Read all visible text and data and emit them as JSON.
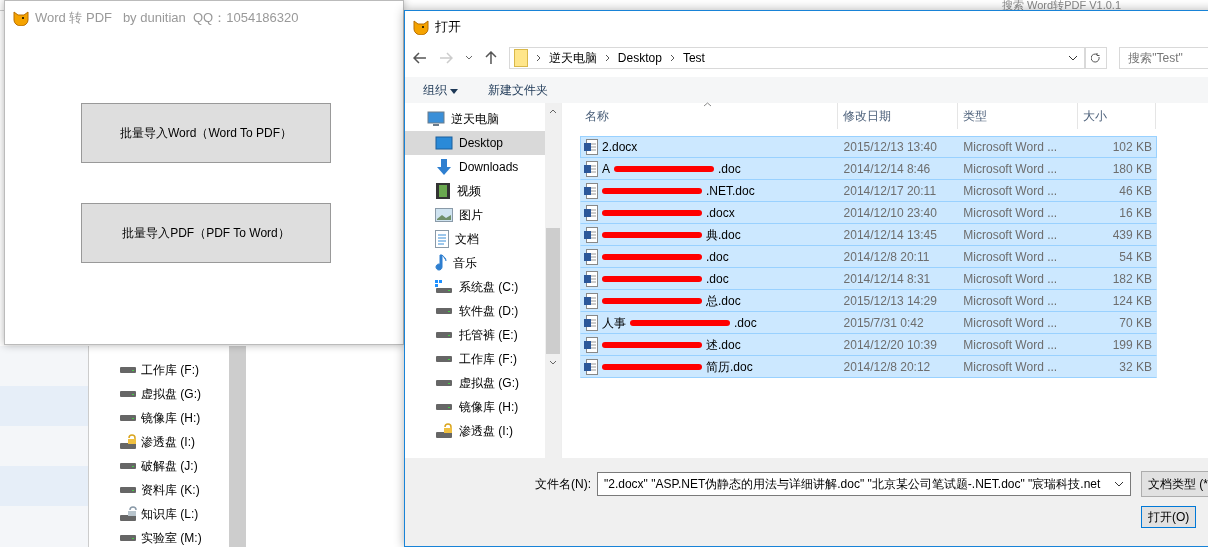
{
  "background_window": {
    "search_placeholder": "搜索 Word转PDF V1.0.1",
    "nav_items": [
      {
        "label": "工作库 (F:)",
        "kind": "drive"
      },
      {
        "label": "虚拟盘 (G:)",
        "kind": "drive"
      },
      {
        "label": "镜像库 (H:)",
        "kind": "drive"
      },
      {
        "label": "渗透盘 (I:)",
        "kind": "locked-drive"
      },
      {
        "label": "破解盘 (J:)",
        "kind": "drive"
      },
      {
        "label": "资料库 (K:)",
        "kind": "drive"
      },
      {
        "label": "知识库 (L:)",
        "kind": "unlocked-drive"
      },
      {
        "label": "实验室 (M:)",
        "kind": "drive"
      }
    ]
  },
  "app_window": {
    "title": "Word 转 PDF   by dunitian  QQ：1054186320",
    "buttons": [
      "批量导入Word（Word To PDF）",
      "批量导入PDF（PDF To Word）"
    ]
  },
  "open_dialog": {
    "title": "打开",
    "breadcrumb": [
      "逆天电脑",
      "Desktop",
      "Test"
    ],
    "search_placeholder": "搜索\"Test\"",
    "toolbar": {
      "organize": "组织",
      "new_folder": "新建文件夹"
    },
    "nav_items": [
      {
        "label": "逆天电脑",
        "kind": "pc",
        "selected": false
      },
      {
        "label": "Desktop",
        "kind": "desktop",
        "selected": true
      },
      {
        "label": "Downloads",
        "kind": "download",
        "selected": false
      },
      {
        "label": "视频",
        "kind": "video",
        "selected": false
      },
      {
        "label": "图片",
        "kind": "picture",
        "selected": false
      },
      {
        "label": "文档",
        "kind": "document",
        "selected": false
      },
      {
        "label": "音乐",
        "kind": "music",
        "selected": false
      },
      {
        "label": "系统盘 (C:)",
        "kind": "system-drive",
        "selected": false
      },
      {
        "label": "软件盘 (D:)",
        "kind": "drive",
        "selected": false
      },
      {
        "label": "托管裤 (E:)",
        "kind": "drive",
        "selected": false
      },
      {
        "label": "工作库 (F:)",
        "kind": "drive",
        "selected": false
      },
      {
        "label": "虚拟盘 (G:)",
        "kind": "drive",
        "selected": false
      },
      {
        "label": "镜像库 (H:)",
        "kind": "drive",
        "selected": false
      },
      {
        "label": "渗透盘 (I:)",
        "kind": "locked-drive",
        "selected": false
      }
    ],
    "columns": [
      "名称",
      "修改日期",
      "类型",
      "大小"
    ],
    "files": [
      {
        "name": "2.docx",
        "redacted": false,
        "date": "2015/12/13 13:40",
        "type": "Microsoft Word ...",
        "size": "102 KB",
        "selected": true
      },
      {
        "name": "A",
        "redacted": true,
        "suffix": ".doc",
        "date": "2014/12/14 8:46",
        "type": "Microsoft Word ...",
        "size": "180 KB",
        "selected": true
      },
      {
        "redacted": true,
        "suffix": ".NET.doc",
        "date": "2014/12/17 20:11",
        "type": "Microsoft Word ...",
        "size": "46 KB",
        "selected": true
      },
      {
        "redacted": true,
        "suffix": ".docx",
        "date": "2014/12/10 23:40",
        "type": "Microsoft Word ...",
        "size": "16 KB",
        "selected": true
      },
      {
        "redacted": true,
        "suffix": "典.doc",
        "date": "2014/12/14 13:45",
        "type": "Microsoft Word ...",
        "size": "439 KB",
        "selected": true
      },
      {
        "redacted": true,
        "suffix": ".doc",
        "date": "2014/12/8 20:11",
        "type": "Microsoft Word ...",
        "size": "54 KB",
        "selected": true
      },
      {
        "redacted": true,
        "suffix": ".doc",
        "date": "2014/12/14 8:31",
        "type": "Microsoft Word ...",
        "size": "182 KB",
        "selected": true
      },
      {
        "redacted": true,
        "suffix": "总.doc",
        "date": "2015/12/13 14:29",
        "type": "Microsoft Word ...",
        "size": "124 KB",
        "selected": true
      },
      {
        "name": "人事",
        "redacted": true,
        "suffix": ".doc",
        "date": "2015/7/31 0:42",
        "type": "Microsoft Word ...",
        "size": "70 KB",
        "selected": true
      },
      {
        "redacted": true,
        "suffix": "述.doc",
        "date": "2014/12/20 10:39",
        "type": "Microsoft Word ...",
        "size": "199 KB",
        "selected": true
      },
      {
        "redacted": true,
        "suffix": "简历.doc",
        "date": "2014/12/8 20:12",
        "type": "Microsoft Word ...",
        "size": "32 KB",
        "selected": true
      }
    ],
    "file_name_label": "文件名(N):",
    "file_name_value": "\"2.docx\" \"ASP.NET伪静态的用法与详细讲解.doc\" \"北京某公司笔试题-.NET.doc\" \"宸瑞科技.net",
    "file_type": "文档类型 (*",
    "open_button": "打开(O)"
  }
}
